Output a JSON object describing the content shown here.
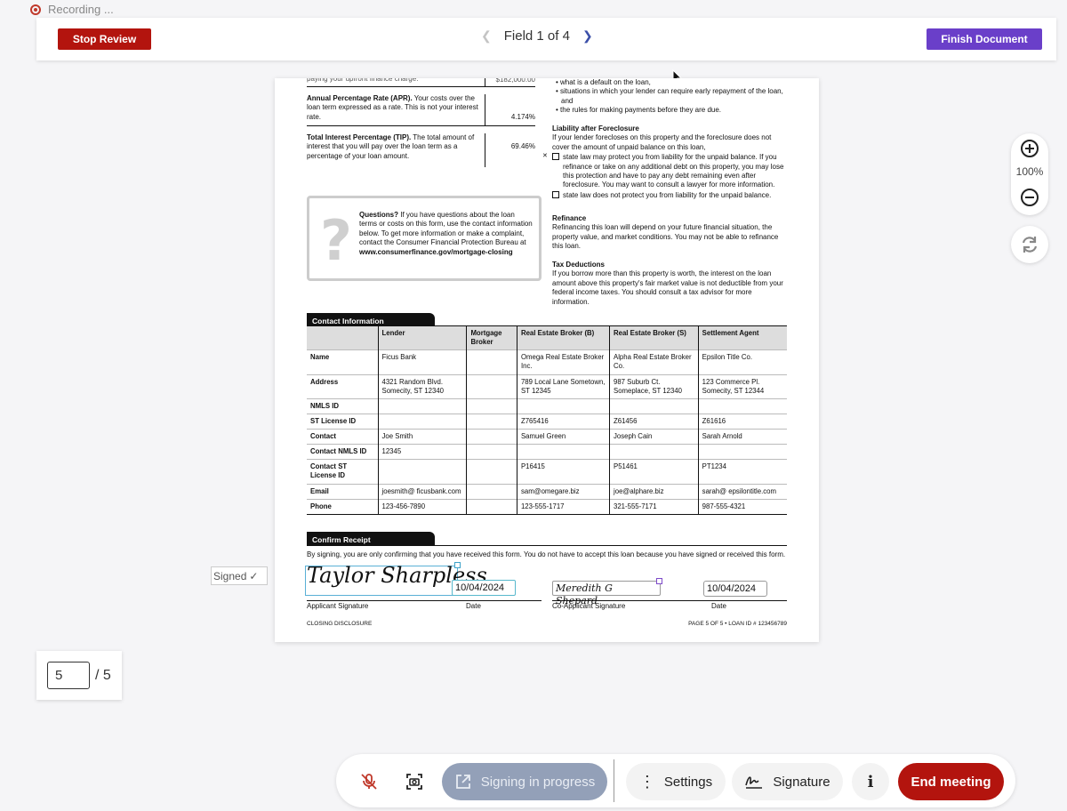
{
  "recording": {
    "label": "Recording ..."
  },
  "topbar": {
    "stop_label": "Stop Review",
    "field_nav": "Field 1 of 4",
    "finish_label": "Finish Document"
  },
  "doc": {
    "top_cut_text": "paying your upfront finance charge.",
    "top_cut_value": "$182,000.00",
    "apr_title": "Annual Percentage Rate (APR).",
    "apr_text": "Your costs over the loan term expressed as a rate. This is not your interest rate.",
    "apr_value": "4.174%",
    "tip_title": "Total Interest Percentage (TIP).",
    "tip_text": "The total amount of interest that you will pay over the loan term as a percentage of your loan amount.",
    "tip_value": "69.46%",
    "questions_title": "Questions?",
    "questions_text": "If you have questions about the loan terms or costs on this form, use the contact information below. To get more information or make a complaint, contact the Consumer Financial Protection Bureau at",
    "questions_url": "www.consumerfinance.gov/mortgage-closing",
    "bullets": [
      "what is a default on the loan,",
      "situations in which your lender can require early repayment of the loan, and",
      "the rules for making payments before they are due."
    ],
    "liability_title": "Liability after Foreclosure",
    "liability_text": "If your lender forecloses on this property and the foreclosure does not cover the amount of unpaid balance on this loan,",
    "liability_opt1": "state law may protect you from liability for the unpaid balance. If you refinance or take on any additional debt on this property, you may lose this protection and have to pay any debt remaining even after foreclosure. You may want to consult a lawyer for more information.",
    "liability_opt2": "state law does not protect you from liability for the unpaid balance.",
    "refinance_title": "Refinance",
    "refinance_text": "Refinancing this loan will depend on your future financial situation, the property value, and market conditions. You may not be able to refinance this loan.",
    "tax_title": "Tax Deductions",
    "tax_text": "If you borrow more than this property is worth, the interest on the loan amount above this property's fair market value is not deductible from your federal income taxes. You should consult a tax advisor for more information.",
    "contact_title": "Contact Information",
    "contact_headers": [
      "",
      "Lender",
      "Mortgage Broker",
      "Real Estate Broker (B)",
      "Real Estate Broker (S)",
      "Settlement Agent"
    ],
    "contact_rows": [
      [
        "Name",
        "Ficus Bank",
        "",
        "Omega Real Estate Broker Inc.",
        "Alpha Real Estate Broker Co.",
        "Epsilon Title Co."
      ],
      [
        "Address",
        "4321 Random Blvd. Somecity, ST 12340",
        "",
        "789 Local Lane Sometown, ST 12345",
        "987 Suburb Ct. Someplace, ST 12340",
        "123 Commerce Pl. Somecity, ST 12344"
      ],
      [
        "NMLS ID",
        "",
        "",
        "",
        "",
        ""
      ],
      [
        "ST License ID",
        "",
        "",
        "Z765416",
        "Z61456",
        "Z61616"
      ],
      [
        "Contact",
        "Joe Smith",
        "",
        "Samuel Green",
        "Joseph Cain",
        "Sarah Arnold"
      ],
      [
        "Contact NMLS ID",
        "12345",
        "",
        "",
        "",
        ""
      ],
      [
        "Contact ST License ID",
        "",
        "",
        "P16415",
        "P51461",
        "PT1234"
      ],
      [
        "Email",
        "joesmith@ ficusbank.com",
        "",
        "sam@omegare.biz",
        "joe@alphare.biz",
        "sarah@ epsilontitle.com"
      ],
      [
        "Phone",
        "123-456-7890",
        "",
        "123-555-1717",
        "321-555-7171",
        "987-555-4321"
      ]
    ],
    "confirm_title": "Confirm Receipt",
    "confirm_text": "By signing, you are only confirming that you have received this form. You do not have to accept this loan because you have signed or received this form.",
    "applicant_signature": "Taylor Sharpless",
    "applicant_date": "10/04/2024",
    "coapplicant_signature": "Meredith G Shepard",
    "coapplicant_date": "10/04/2024",
    "applicant_label": "Applicant Signature",
    "coapplicant_label": "Co-Applicant Signature",
    "date_label": "Date",
    "footer_left": "CLOSING DISCLOSURE",
    "footer_right": "PAGE 5 OF 5 • LOAN ID # 123456789"
  },
  "signed_tag": "Signed",
  "zoom": {
    "label": "100%"
  },
  "pagination": {
    "current": "5",
    "total": "/ 5"
  },
  "bottom_bar": {
    "progress_label": "Signing in progress",
    "settings_label": "Settings",
    "signature_label": "Signature",
    "info_label": "i",
    "end_label": "End meeting"
  },
  "colors": {
    "stop": "#b3140e",
    "finish": "#6a3fc9",
    "end_meeting": "#b3140e",
    "progress": "#93a0b8"
  }
}
